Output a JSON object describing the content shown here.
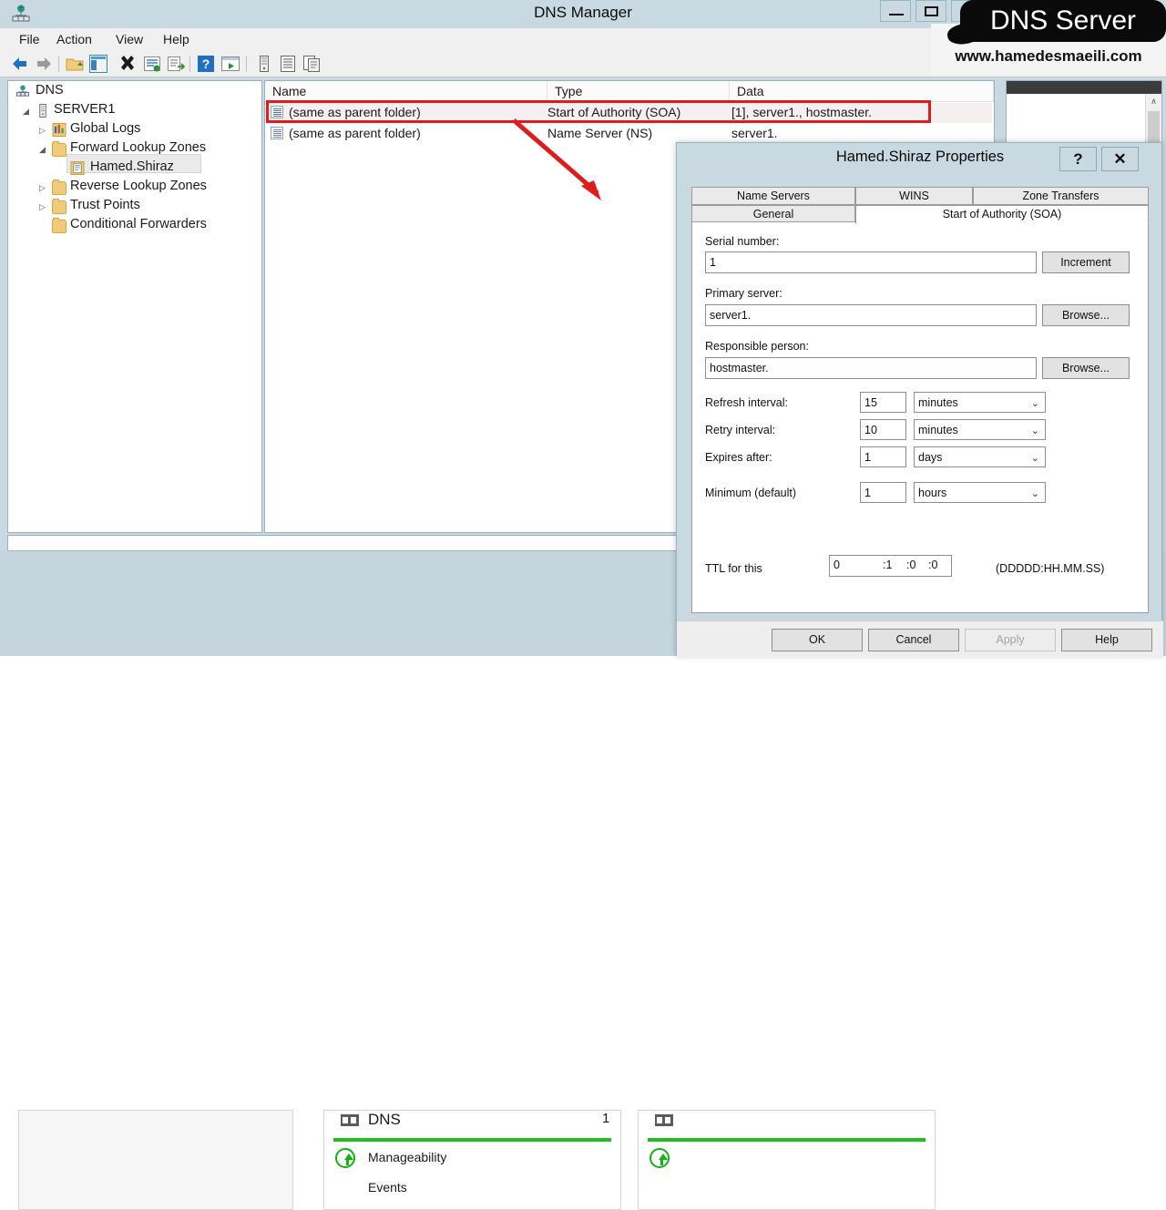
{
  "window": {
    "title": "DNS Manager",
    "app_icon": "dns-server-icon",
    "buttons": {
      "minimize": "minimize-icon",
      "maximize": "restore-icon",
      "close": "close-icon"
    }
  },
  "menubar": {
    "items": [
      "File",
      "Action",
      "View",
      "Help"
    ]
  },
  "toolbar": {
    "icons": [
      "back-arrow-icon",
      "forward-arrow-icon",
      "up-folder-icon",
      "show-hide-tree-icon",
      "delete-icon",
      "properties-icon",
      "export-list-icon",
      "help-icon",
      "run-icon",
      "server-icon",
      "list-icon",
      "copy-icon"
    ]
  },
  "tree": {
    "items": [
      {
        "label": "DNS",
        "indent": 0,
        "expander": "",
        "icon": "dns-root-icon",
        "selected": false
      },
      {
        "label": "SERVER1",
        "indent": 1,
        "expander": "expanded",
        "icon": "server-icon",
        "selected": false
      },
      {
        "label": "Global Logs",
        "indent": 2,
        "expander": "collapsed",
        "icon": "logs-icon",
        "selected": false
      },
      {
        "label": "Forward Lookup Zones",
        "indent": 2,
        "expander": "expanded",
        "icon": "folder-icon",
        "selected": false
      },
      {
        "label": "Hamed.Shiraz",
        "indent": 3,
        "expander": "",
        "icon": "zone-icon",
        "selected": true
      },
      {
        "label": "Reverse Lookup Zones",
        "indent": 2,
        "expander": "collapsed",
        "icon": "folder-icon",
        "selected": false
      },
      {
        "label": "Trust Points",
        "indent": 2,
        "expander": "collapsed",
        "icon": "folder-icon",
        "selected": false
      },
      {
        "label": "Conditional Forwarders",
        "indent": 2,
        "expander": "",
        "icon": "folder-icon",
        "selected": false
      }
    ]
  },
  "list": {
    "columns": [
      "Name",
      "Type",
      "Data"
    ],
    "rows": [
      {
        "name": "(same as parent folder)",
        "type": "Start of Authority (SOA)",
        "data": "[1], server1., hostmaster.",
        "selected": true
      },
      {
        "name": "(same as parent folder)",
        "type": "Name Server (NS)",
        "data": "server1.",
        "selected": false
      }
    ]
  },
  "dialog": {
    "title": "Hamed.Shiraz Properties",
    "help_button": "?",
    "close_button": "✕",
    "tabs_row1": [
      "Name Servers",
      "WINS",
      "Zone Transfers"
    ],
    "tabs_row2": [
      "General",
      "Start of Authority (SOA)"
    ],
    "active_tab": "Start of Authority (SOA)",
    "fields": {
      "serial_label": "Serial number:",
      "serial_value": "1",
      "increment_button": "Increment",
      "primary_label": "Primary server:",
      "primary_value": "server1.",
      "primary_browse_button": "Browse...",
      "responsible_label": "Responsible person:",
      "responsible_value": "hostmaster.",
      "responsible_browse_button": "Browse..."
    },
    "intervals": [
      {
        "label": "Refresh interval:",
        "value": "15",
        "unit": "minutes"
      },
      {
        "label": "Retry interval:",
        "value": "10",
        "unit": "minutes"
      },
      {
        "label": "Expires after:",
        "value": "1",
        "unit": "days"
      },
      {
        "label": "Minimum (default)",
        "value": "1",
        "unit": "hours"
      }
    ],
    "ttl": {
      "label": "TTL for this",
      "days": "0",
      "hours": ":1",
      "minutes": ":0",
      "seconds": ":0",
      "format_hint": "(DDDDD:HH.MM.SS)"
    },
    "footer_buttons": [
      {
        "label": "OK",
        "disabled": false
      },
      {
        "label": "Cancel",
        "disabled": false
      },
      {
        "label": "Apply",
        "disabled": true
      },
      {
        "label": "Help",
        "disabled": false
      }
    ]
  },
  "server_manager": {
    "tiles": [
      {
        "title": "DNS",
        "count": "1",
        "items": [
          "Manageability",
          "Events"
        ]
      }
    ],
    "accent_color": "#20c020"
  },
  "annotations": {
    "highlight_color": "#e01b1b",
    "row_highlight": "Start of Authority (SOA) row",
    "bracket": "SOA interval fields"
  },
  "watermark": {
    "title": "DNS Server",
    "url": "www.hamedesmaeili.com"
  }
}
